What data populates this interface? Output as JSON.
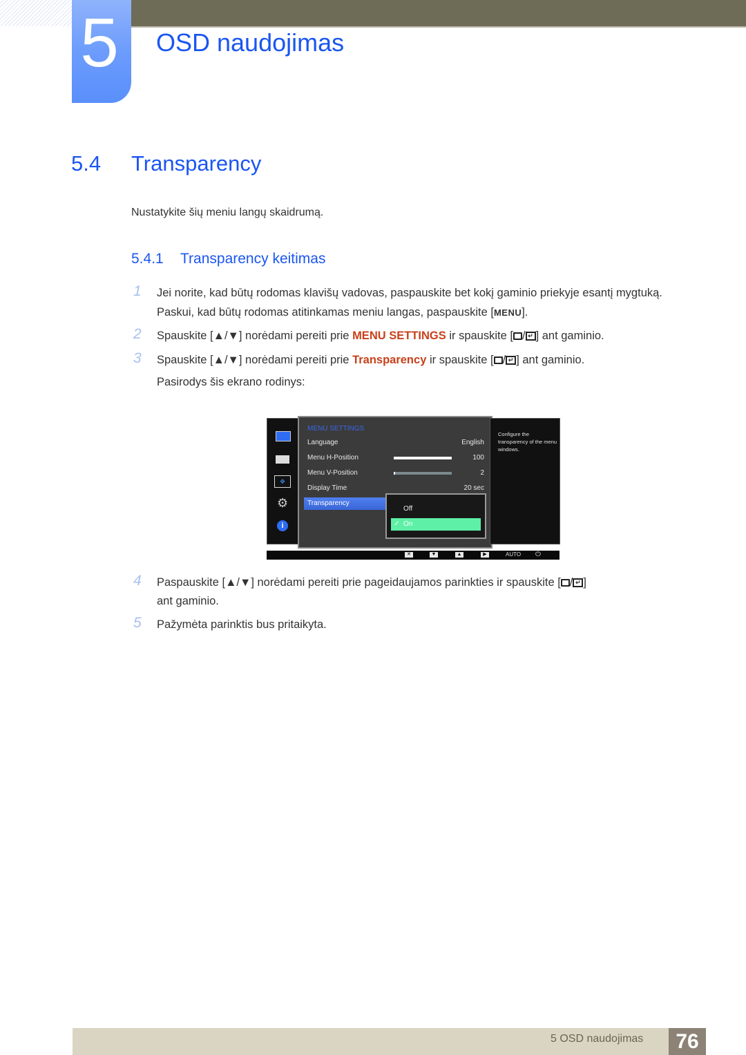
{
  "chapter": {
    "number": "5",
    "title": "OSD naudojimas"
  },
  "section": {
    "number": "5.4",
    "title": "Transparency",
    "intro": "Nustatykite šių meniu langų skaidrumą."
  },
  "subsection": {
    "number": "5.4.1",
    "title": "Transparency keitimas"
  },
  "steps": {
    "s1": {
      "n": "1",
      "line1": "Jei norite, kad būtų rodomas klavišų vadovas, paspauskite bet kokį gaminio priekyje esantį mygtuką.",
      "line2a": "Paskui, kad būtų rodomas atitinkamas meniu langas, paspauskite [",
      "key": "MENU",
      "line2b": "]."
    },
    "s2": {
      "n": "2",
      "a": "Spauskite [",
      "arrows": "▲/▼",
      "b": "] norėdami pereiti prie ",
      "hl": "MENU SETTINGS",
      "c": " ir spauskite [",
      "sep": "/",
      "d": "] ant gaminio."
    },
    "s3": {
      "n": "3",
      "a": "Spauskite [",
      "arrows": "▲/▼",
      "b": "] norėdami pereiti prie ",
      "hl": "Transparency",
      "c": " ir spauskite [",
      "sep": "/",
      "d": "] ant gaminio.",
      "line2": "Pasirodys šis ekrano rodinys:"
    },
    "s4": {
      "n": "4",
      "a": "Paspauskite [",
      "arrows": "▲/▼",
      "b": "] norėdami pereiti prie pageidaujamos parinkties ir spauskite [",
      "sep": "/",
      "c": "]",
      "line2": "ant gaminio."
    },
    "s5": {
      "n": "5",
      "text": "Pažymėta parinktis bus pritaikyta."
    }
  },
  "osd": {
    "heading": "MENU SETTINGS",
    "rows": [
      {
        "label": "Language",
        "value": "English"
      },
      {
        "label": "Menu H-Position",
        "value": "100",
        "level": 1.0
      },
      {
        "label": "Menu V-Position",
        "value": "2",
        "level": 0.02
      },
      {
        "label": "Display Time",
        "value": "20 sec"
      }
    ],
    "selected_item": "Transparency",
    "options": [
      {
        "label": "Off",
        "checked": ""
      },
      {
        "label": "On",
        "checked": "✓"
      }
    ],
    "help": "Configure the transparency of the menu windows.",
    "bottom": {
      "close": "✕",
      "down": "▼",
      "up": "▲",
      "right": "▶",
      "auto": "AUTO",
      "power": "⏻"
    },
    "colors": {
      "heading": "#3a66e8",
      "selected_option": "#5ef0a6"
    }
  },
  "footer": {
    "text": "5 OSD naudojimas",
    "page": "76"
  },
  "colors": {
    "brand_blue": "#1a56f0",
    "highlight": "#c8401a",
    "step_number": "#a9bff0"
  }
}
